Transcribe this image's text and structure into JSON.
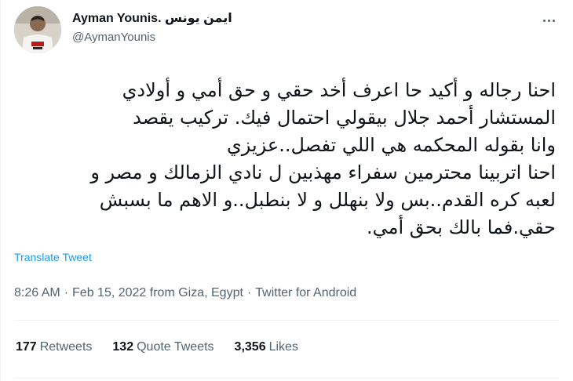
{
  "user": {
    "display_name": "Ayman Younis. ايمن يونس",
    "handle": "@AymanYounis",
    "avatar_icon": "profile-photo-jersey"
  },
  "menu_icon": "more-dots-icon",
  "tweet_lines": [
    "احنا رجاله و أكيد حا اعرف أخد حقي و حق أمي و أولادي",
    "المستشار أحمد جلال بيقولي احتمال فيك. تركيب يقصد",
    "وانا بقوله المحكمه هي اللي تفصل..عزيزي",
    "احنا اتربينا محترمين سفراء مهذبين ل نادي الزمالك و مصر و",
    "لعبه كره القدم..بس ولا بنهلل و لا بنطبل..و الاهم  ما بسبش",
    "حقي.فما بالك بحق أمي."
  ],
  "translate_label": "Translate Tweet",
  "meta": {
    "time": "8:26 AM",
    "date_place": "Feb 15, 2022 from Giza, Egypt",
    "source": "Twitter for Android",
    "separator": "·"
  },
  "stats": {
    "retweets_count": "177",
    "retweets_label": "Retweets",
    "quotes_count": "132",
    "quotes_label": "Quote Tweets",
    "likes_count": "3,356",
    "likes_label": "Likes"
  },
  "colors": {
    "link": "#1d9bf0",
    "secondary": "#536471",
    "primary": "#0f1419",
    "divider": "#eff3f4"
  }
}
